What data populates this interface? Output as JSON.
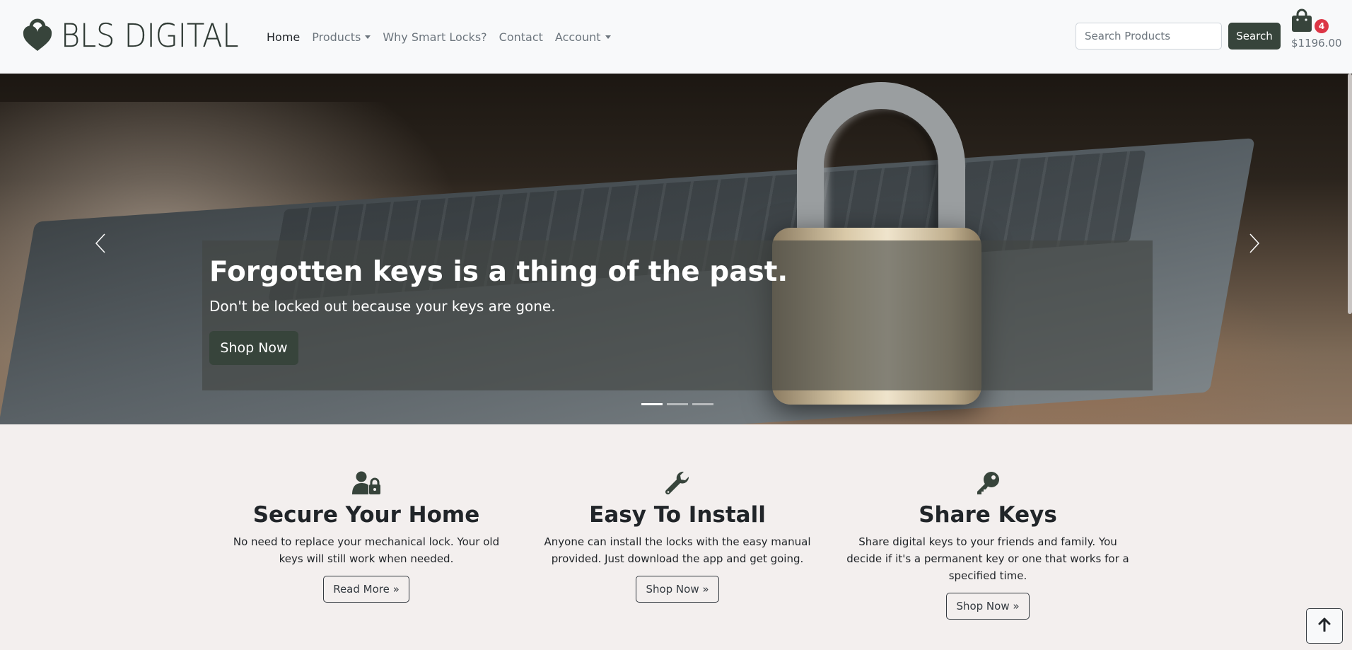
{
  "brand": {
    "name": "BLS DIGITAL",
    "logo_icon": "heart-lock-icon"
  },
  "nav": {
    "home": "Home",
    "products": "Products",
    "why": "Why Smart Locks?",
    "contact": "Contact",
    "account": "Account"
  },
  "search": {
    "placeholder": "Search Products",
    "button": "Search"
  },
  "cart": {
    "icon": "shopping-bag-icon",
    "count": "4",
    "total": "$1196.00"
  },
  "hero": {
    "title": "Forgotten keys is a thing of the past.",
    "subtitle": "Don't be locked out because your keys are gone.",
    "button": "Shop Now",
    "slides": 3,
    "active_slide": 1
  },
  "features": [
    {
      "icon": "user-lock-icon",
      "title": "Secure Your Home",
      "text": "No need to replace your mechanical lock. Your old keys will still work when needed.",
      "button": "Read More »"
    },
    {
      "icon": "wrench-icon",
      "title": "Easy To Install",
      "text": "Anyone can install the locks with the easy manual provided. Just download the app and get going.",
      "button": "Shop Now »"
    },
    {
      "icon": "key-icon",
      "title": "Share Keys",
      "text": "Share digital keys to your friends and family. You decide if it's a permanent key or one that works for a specified time.",
      "button": "Shop Now »"
    }
  ],
  "colors": {
    "brand_dark": "#37443b",
    "badge": "#dc3545",
    "page_bg": "#f3efee"
  }
}
